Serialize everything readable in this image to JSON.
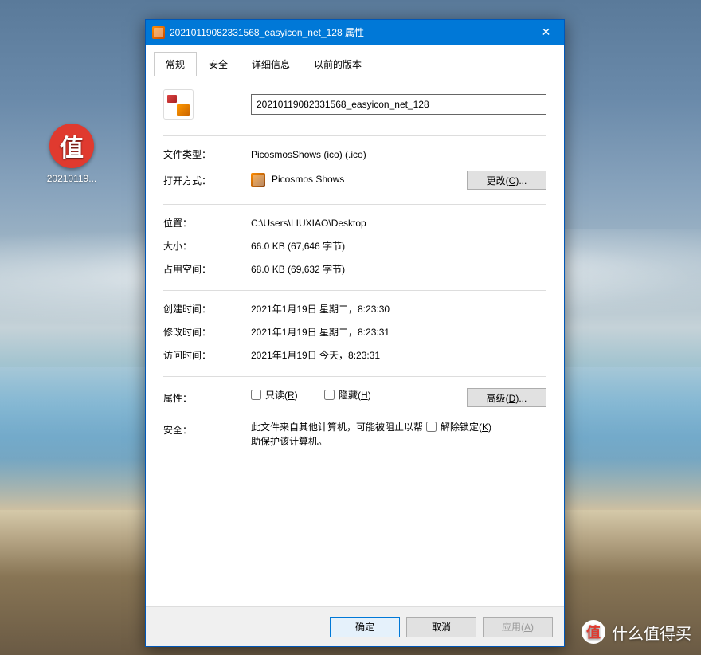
{
  "desktop": {
    "icon_label": "20210119...",
    "icon_glyph": "值"
  },
  "dialog": {
    "title": "20210119082331568_easyicon_net_128 属性",
    "tabs": [
      "常规",
      "安全",
      "详细信息",
      "以前的版本"
    ],
    "filename": "20210119082331568_easyicon_net_128",
    "labels": {
      "filetype": "文件类型：",
      "openwith": "打开方式：",
      "location": "位置：",
      "size": "大小：",
      "sizeondisk": "占用空间：",
      "created": "创建时间：",
      "modified": "修改时间：",
      "accessed": "访问时间：",
      "attributes": "属性：",
      "security": "安全："
    },
    "values": {
      "filetype": "PicosmosShows (ico) (.ico)",
      "openwith_app": "Picosmos Shows",
      "location": "C:\\Users\\LIUXIAO\\Desktop",
      "size": "66.0 KB (67,646 字节)",
      "sizeondisk": "68.0 KB (69,632 字节)",
      "created": "2021年1月19日 星期二，8:23:30",
      "modified": "2021年1月19日 星期二，8:23:31",
      "accessed": "2021年1月19日 今天，8:23:31",
      "security_text": "此文件来自其他计算机，可能被阻止以帮助保护该计算机。"
    },
    "checkboxes": {
      "readonly": "只读(R)",
      "hidden": "隐藏(H)",
      "unblock": "解除锁定(K)"
    },
    "buttons": {
      "change": "更改(C)...",
      "advanced": "高级(D)...",
      "ok": "确定",
      "cancel": "取消",
      "apply": "应用(A)"
    }
  },
  "watermark": {
    "glyph": "值",
    "text": "什么值得买"
  }
}
